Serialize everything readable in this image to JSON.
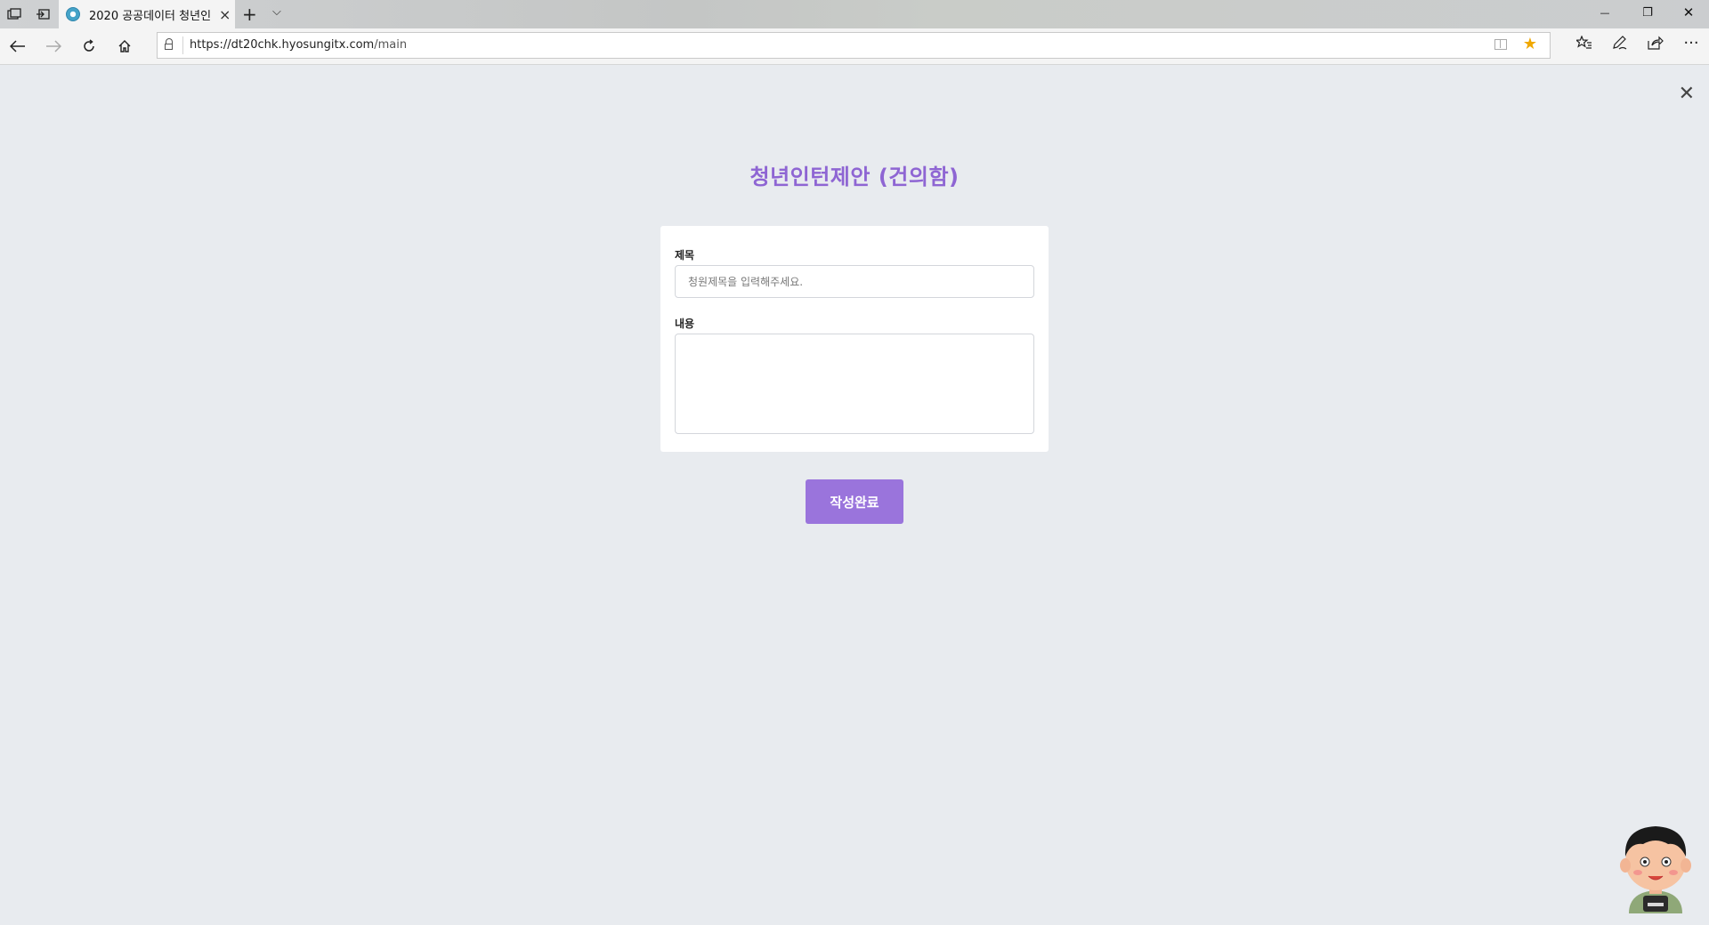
{
  "browser": {
    "tab": {
      "title": "2020 공공데이터 청년인",
      "close_label": "×"
    },
    "new_tab_label": "+",
    "tab_menu_label": "⌵",
    "window_controls": {
      "minimize": "—",
      "restore": "❐",
      "close": "✕"
    },
    "address_bar": {
      "url_host": "https://dt20chk.hyosungitx.com",
      "url_path": "/main"
    }
  },
  "page": {
    "close_label": "✕",
    "title": "청년인턴제안 (건의함)",
    "form": {
      "subject_label": "제목",
      "subject_placeholder": "청원제목을 입력해주세요.",
      "subject_value": "",
      "content_label": "내용",
      "content_value": ""
    },
    "submit_label": "작성완료"
  },
  "colors": {
    "accent": "#9a74dc",
    "title": "#8e65d3",
    "background": "#e8ebef",
    "favorite_star": "#f0a800"
  }
}
